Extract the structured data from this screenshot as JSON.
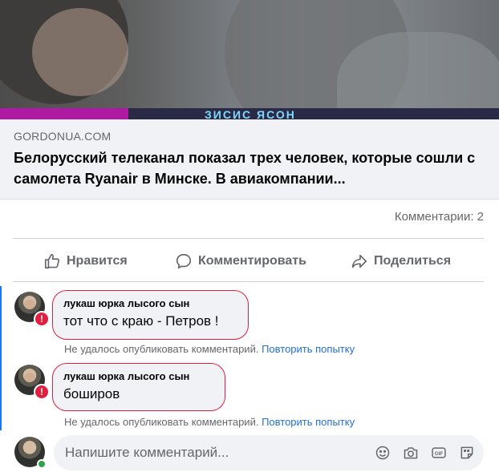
{
  "preview": {
    "image_strip_text": "ЗИСИС ЯСОН",
    "domain": "GORDONUA.COM",
    "title": "Белорусский телеканал показал трех человек, которые сошли с самолета Ryanair в Минске. В авиакомпании..."
  },
  "stats": {
    "comments_label": "Комментарии: 2"
  },
  "actions": {
    "like": "Нравится",
    "comment": "Комментировать",
    "share": "Поделиться"
  },
  "comments": [
    {
      "author": "лукаш юрка лысого сын",
      "text": "тот что с краю - Петров !",
      "error": "Не удалось опубликовать комментарий.",
      "retry": "Повторить попытку",
      "badge": "!"
    },
    {
      "author": "лукаш юрка лысого сын",
      "text": "боширов",
      "error": "Не удалось опубликовать комментарий.",
      "retry": "Повторить попытку",
      "badge": "!"
    }
  ],
  "composer": {
    "placeholder": "Напишите комментарий...",
    "icons": [
      "emoji-icon",
      "camera-icon",
      "gif-icon",
      "sticker-icon"
    ]
  },
  "colors": {
    "accent": "#1877f2",
    "error": "#e41e3f",
    "link": "#216fdb",
    "muted": "#65676b",
    "online": "#31a24c"
  }
}
